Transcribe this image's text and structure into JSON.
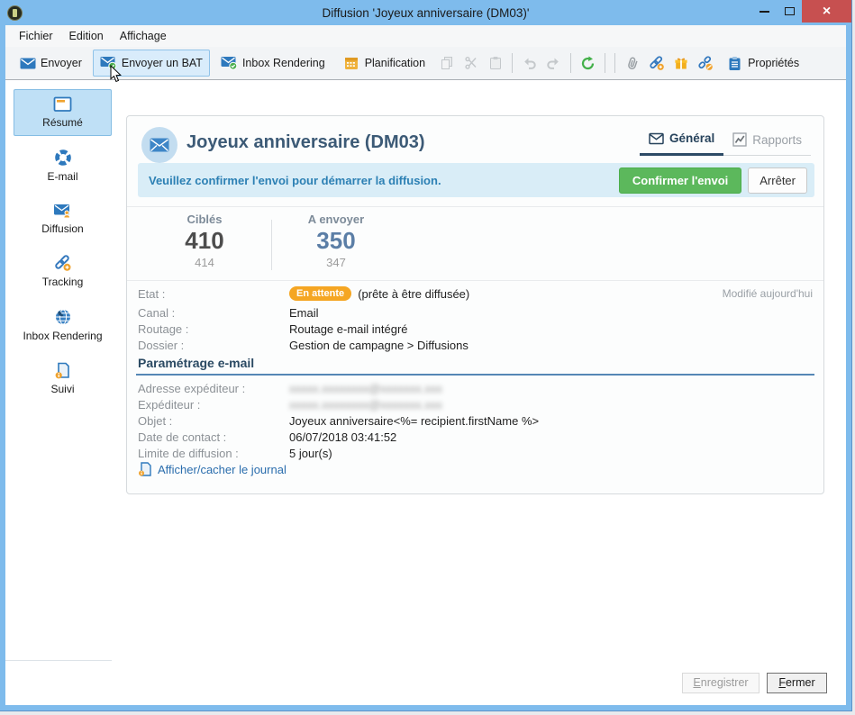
{
  "window": {
    "title": "Diffusion 'Joyeux anniversaire (DM03)'",
    "close_glyph": "×"
  },
  "menubar": {
    "items": [
      {
        "label": "Fichier"
      },
      {
        "label": "Edition"
      },
      {
        "label": "Affichage"
      }
    ]
  },
  "toolbar": {
    "buttons": [
      {
        "label": "Envoyer",
        "icon": "send-envelope-icon",
        "hover": false
      },
      {
        "label": "Envoyer un BAT",
        "icon": "envelope-check-icon",
        "hover": true
      },
      {
        "label": "Inbox Rendering",
        "icon": "envelope-check-icon",
        "hover": false
      },
      {
        "label": "Planification",
        "icon": "calendar-icon",
        "hover": false
      }
    ],
    "tools": [
      {
        "name": "copy",
        "enabled": false
      },
      {
        "name": "cut",
        "enabled": false
      },
      {
        "name": "paste",
        "enabled": false
      },
      {
        "name": "undo",
        "enabled": false
      },
      {
        "name": "redo",
        "enabled": false
      },
      {
        "name": "refresh",
        "enabled": true
      },
      {
        "name": "attachment",
        "enabled": true
      },
      {
        "name": "link",
        "enabled": true
      },
      {
        "name": "gift",
        "enabled": true
      },
      {
        "name": "unlink",
        "enabled": true
      }
    ],
    "properties_label": "Propriétés"
  },
  "sidebar": {
    "items": [
      {
        "label": "Résumé",
        "icon": "window-icon",
        "selected": true
      },
      {
        "label": "E-mail",
        "icon": "content-ring-icon",
        "selected": false
      },
      {
        "label": "Diffusion",
        "icon": "envelope-user-icon",
        "selected": false
      },
      {
        "label": "Tracking",
        "icon": "link-icon",
        "selected": false
      },
      {
        "label": "Inbox Rendering",
        "icon": "globe-icon",
        "selected": false
      },
      {
        "label": "Suivi",
        "icon": "doc-info-icon",
        "selected": false
      }
    ]
  },
  "main": {
    "title": "Joyeux anniversaire (DM03)",
    "tabs": [
      {
        "label": "Général",
        "icon": "envelope-outline-icon",
        "active": true
      },
      {
        "label": "Rapports",
        "icon": "chart-icon",
        "active": false
      }
    ],
    "banner": {
      "message": "Veuillez confirmer l'envoi pour démarrer la diffusion.",
      "confirm_label": "Confirmer l'envoi",
      "stop_label": "Arrêter"
    },
    "stats": [
      {
        "label": "Ciblés",
        "value": "410",
        "secondary": "414"
      },
      {
        "label": "A envoyer",
        "value": "350",
        "secondary": "347"
      }
    ],
    "info": {
      "etat_label": "Etat :",
      "etat_badge": "En attente",
      "etat_value": "(prête à être diffusée)",
      "modified": "Modifié aujourd'hui",
      "canal_label": "Canal :",
      "canal_value": "Email",
      "routage_label": "Routage :",
      "routage_value": "Routage e-mail intégré",
      "dossier_label": "Dossier :",
      "dossier_value": "Gestion de campagne > Diffusions"
    },
    "email_settings": {
      "title": "Paramétrage e-mail",
      "rows": [
        {
          "label": "Adresse expéditeur :",
          "value": "xxxxx.xxxxxxxx@xxxxxxx.xxx",
          "redacted": true
        },
        {
          "label": "Expéditeur :",
          "value": "xxxxx.xxxxxxxx@xxxxxxx.xxx",
          "redacted": true
        },
        {
          "label": "Objet :",
          "value": "Joyeux anniversaire<%= recipient.firstName %>",
          "redacted": false
        },
        {
          "label": "Date de contact :",
          "value": "06/07/2018 03:41:52",
          "redacted": false
        },
        {
          "label": "Limite de diffusion :",
          "value": "5 jour(s)",
          "redacted": false
        }
      ],
      "journal_link": "Afficher/cacher le journal"
    }
  },
  "footer": {
    "save_label": "Enregistrer",
    "close_label": "Fermer"
  },
  "colors": {
    "titlebar_blue": "#7EBBEC",
    "close_red": "#C75050",
    "accent_blue": "#2E79BD",
    "orange": "#F0A32F",
    "badge_orange": "#F5A623",
    "confirm_green": "#5CB85C",
    "banner_bg": "#D9EDF7",
    "banner_text": "#2C80B4",
    "stat_blue": "#5B7EA6"
  }
}
